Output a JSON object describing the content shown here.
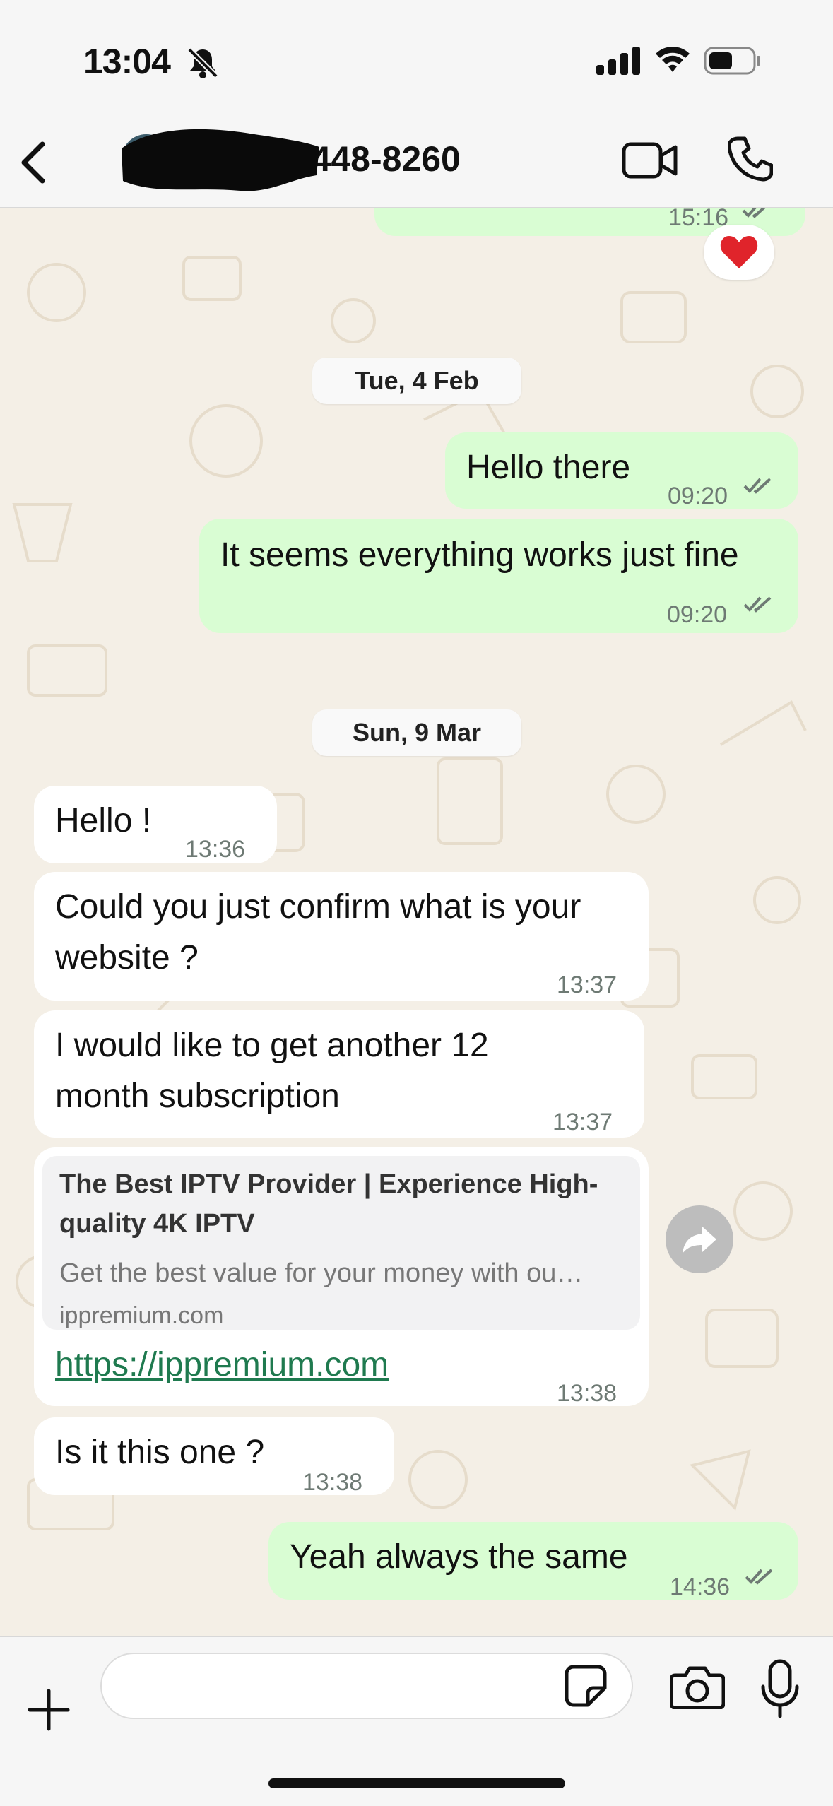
{
  "status_bar": {
    "time": "13:04"
  },
  "header": {
    "contact_name": ") 448-8260"
  },
  "chat": {
    "dates": [
      "Tue, 4 Feb",
      "Sun, 9 Mar"
    ],
    "prev_time": "15:16",
    "reaction": "❤️",
    "messages": [
      {
        "id": "m1",
        "direction": "out",
        "text": "Hello there",
        "time": "09:20"
      },
      {
        "id": "m2",
        "direction": "out",
        "text": "It seems everything works just fine",
        "time": "09:20"
      },
      {
        "id": "m3",
        "direction": "in",
        "text": "Hello !",
        "time": "13:36"
      },
      {
        "id": "m4",
        "direction": "in",
        "text_lines": [
          "Could you just confirm what is your",
          "website ?"
        ],
        "time": "13:37"
      },
      {
        "id": "m5",
        "direction": "in",
        "text_lines": [
          "I would like to get another 12",
          "month subscription"
        ],
        "time": "13:37"
      },
      {
        "id": "m6",
        "direction": "in",
        "link": "https://ippremium.com",
        "time": "13:38",
        "preview": {
          "title_lines": [
            "The Best IPTV Provider | Experience High-",
            "quality 4K IPTV"
          ],
          "description": "Get the best value for your money with ou…",
          "domain": "ippremium.com"
        }
      },
      {
        "id": "m7",
        "direction": "in",
        "text": "Is it this one ?",
        "time": "13:38"
      },
      {
        "id": "m8",
        "direction": "out",
        "text": "Yeah always the same",
        "time": "14:36"
      }
    ]
  },
  "colors": {
    "outgoing_bubble": "#d9fdd3",
    "incoming_bubble": "#ffffff",
    "chat_background": "#f4efe6",
    "read_ticks": "#6e7a74",
    "link": "#1f7a4f"
  },
  "icons": [
    "bell-off-icon",
    "signal-icon",
    "wifi-icon",
    "battery-icon",
    "back-chevron-icon",
    "video-call-icon",
    "phone-call-icon",
    "double-tick-icon",
    "heart-icon",
    "forward-icon",
    "plus-icon",
    "sticker-icon",
    "camera-icon",
    "microphone-icon"
  ]
}
